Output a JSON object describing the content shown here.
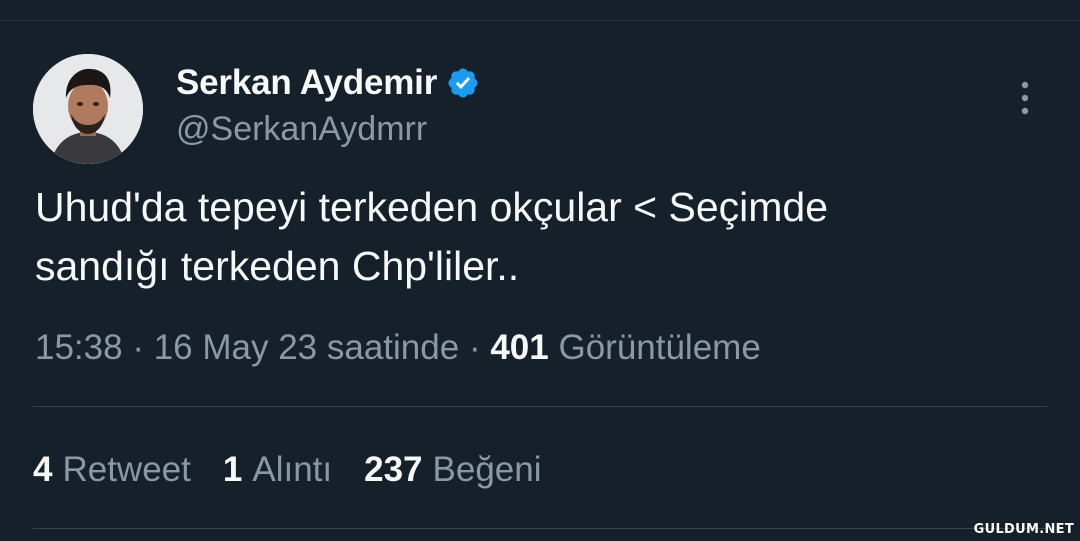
{
  "author": {
    "display_name": "Serkan Aydemir",
    "handle": "@SerkanAydmrr",
    "avatar_icon": "user-photo-icon",
    "verified_icon": "verified-badge-icon",
    "verified_color": "#1d9bf0"
  },
  "more_icon": "more-vertical-icon",
  "tweet": {
    "lines": [
      "Uhud'da tepeyi terkeden okçular < Seçimde",
      "sandığı terkeden Chp'liler.."
    ]
  },
  "meta": {
    "time": "15:38",
    "separator": "·",
    "date": "16 May 23 saatinde",
    "views_count": "401",
    "views_label": "Görüntüleme"
  },
  "stats": {
    "retweets_count": "4",
    "retweets_label": "Retweet",
    "quotes_count": "1",
    "quotes_label": "Alıntı",
    "likes_count": "237",
    "likes_label": "Beğeni"
  },
  "watermark": "GULDUM.NET",
  "colors": {
    "background": "#15202b",
    "primary_text": "#f7f9f9",
    "secondary_text": "#8b98a5",
    "divider": "#38444d"
  }
}
